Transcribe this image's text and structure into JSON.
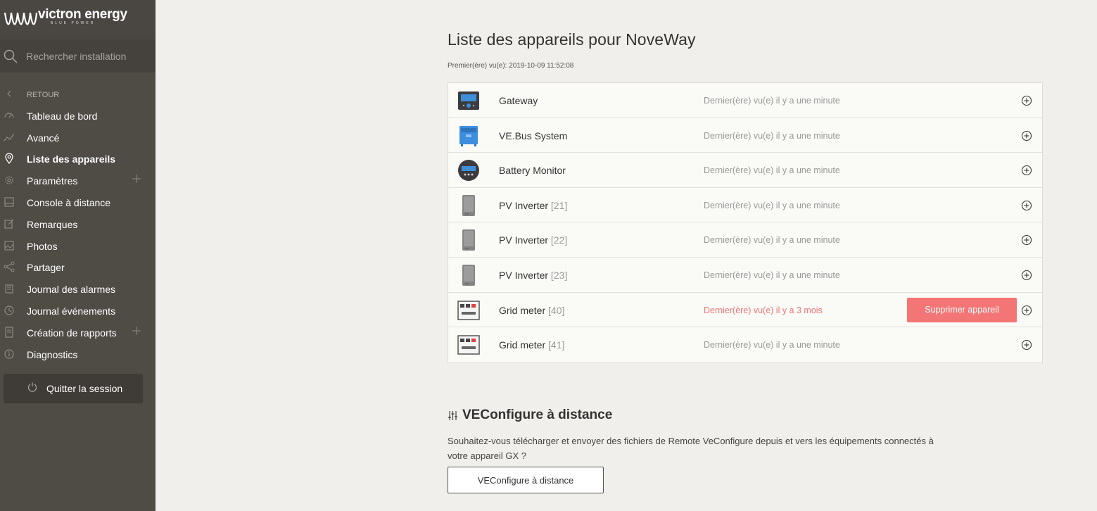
{
  "brand": {
    "name": "victron energy",
    "tagline": "BLUE POWER"
  },
  "search": {
    "placeholder": "Rechercher installation"
  },
  "sidebar": {
    "back_label": "RETOUR",
    "items": [
      {
        "label": "Tableau de bord",
        "icon": "dashboard-icon"
      },
      {
        "label": "Avancé",
        "icon": "advanced-icon"
      },
      {
        "label": "Liste des appareils",
        "icon": "location-pin-icon",
        "active": true
      },
      {
        "label": "Paramètres",
        "icon": "gear-icon",
        "expandable": true
      },
      {
        "label": "Console à distance",
        "icon": "console-icon"
      },
      {
        "label": "Remarques",
        "icon": "edit-icon"
      },
      {
        "label": "Photos",
        "icon": "photo-icon"
      },
      {
        "label": "Partager",
        "icon": "share-icon"
      },
      {
        "label": "Journal des alarmes",
        "icon": "alarm-log-icon"
      },
      {
        "label": "Journal événements",
        "icon": "event-log-icon"
      },
      {
        "label": "Création de rapports",
        "icon": "report-icon",
        "expandable": true
      },
      {
        "label": "Diagnostics",
        "icon": "info-icon"
      }
    ],
    "logout_label": "Quitter la session"
  },
  "main": {
    "title": "Liste des appareils pour NoveWay",
    "first_seen": "Premier(ère) vu(e): 2019-10-09 11:52:08",
    "devices": [
      {
        "name": "Gateway",
        "instance": "",
        "last_seen": "Dernier(ère) vu(e) il y a une minute",
        "icon": "gateway-icon",
        "warn": false
      },
      {
        "name": "VE.Bus System",
        "instance": "",
        "last_seen": "Dernier(ère) vu(e) il y a une minute",
        "icon": "vebus-icon",
        "warn": false
      },
      {
        "name": "Battery Monitor",
        "instance": "",
        "last_seen": "Dernier(ère) vu(e) il y a une minute",
        "icon": "battery-monitor-icon",
        "warn": false
      },
      {
        "name": "PV Inverter",
        "instance": "[21]",
        "last_seen": "Dernier(ère) vu(e) il y a une minute",
        "icon": "pv-inverter-icon",
        "warn": false
      },
      {
        "name": "PV Inverter",
        "instance": "[22]",
        "last_seen": "Dernier(ère) vu(e) il y a une minute",
        "icon": "pv-inverter-icon",
        "warn": false
      },
      {
        "name": "PV Inverter",
        "instance": "[23]",
        "last_seen": "Dernier(ère) vu(e) il y a une minute",
        "icon": "pv-inverter-icon",
        "warn": false
      },
      {
        "name": "Grid meter",
        "instance": "[40]",
        "last_seen": "Dernier(ère) vu(e) il y a 3 mois",
        "icon": "grid-meter-icon",
        "warn": true,
        "action": "Supprimer appareil"
      },
      {
        "name": "Grid meter",
        "instance": "[41]",
        "last_seen": "Dernier(ère) vu(e) il y a une minute",
        "icon": "grid-meter-icon",
        "warn": false
      }
    ],
    "veconfigure": {
      "title": "VEConfigure à distance",
      "description": "Souhaitez-vous télécharger et envoyer des fichiers de Remote VeConfigure depuis et vers les équipements connectés à votre appareil GX ?",
      "button_label": "VEConfigure à distance"
    }
  },
  "colors": {
    "sidebar_bg": "#4f4c46",
    "page_bg": "#f0efeb",
    "warn": "#f07575",
    "delete_button": "#f37575"
  }
}
